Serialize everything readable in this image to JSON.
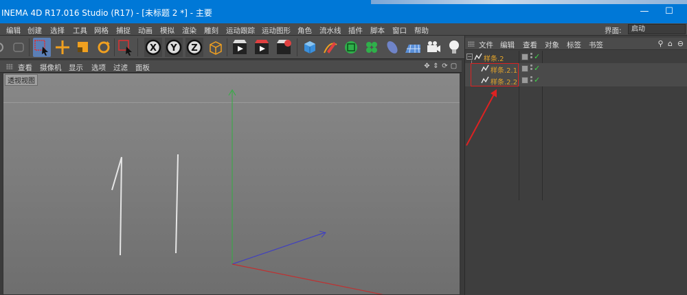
{
  "window": {
    "title": "INEMA 4D R17.016 Studio (R17) - [未标题 2 *] - 主要",
    "minimize_glyph": "—",
    "maximize_glyph": "☐"
  },
  "menubar": {
    "items": [
      "编辑",
      "创建",
      "选择",
      "工具",
      "网格",
      "捕捉",
      "动画",
      "模拟",
      "渲染",
      "雕刻",
      "运动跟踪",
      "运动图形",
      "角色",
      "流水线",
      "插件",
      "脚本",
      "窗口",
      "帮助"
    ],
    "layout_label": "界面:",
    "layout_value": "启动"
  },
  "toolbar": {
    "axis_x": "X",
    "axis_y": "Y",
    "axis_z": "Z"
  },
  "viewport_menu": {
    "items": [
      "查看",
      "摄像机",
      "显示",
      "选项",
      "过滤",
      "面板"
    ]
  },
  "viewport": {
    "label": "透视视图"
  },
  "object_manager": {
    "menu": [
      "文件",
      "编辑",
      "查看",
      "对象",
      "标签",
      "书签"
    ],
    "objects": [
      {
        "name": "样条.2"
      },
      {
        "name": "样条.2.1"
      },
      {
        "name": "样条.2.2"
      }
    ]
  },
  "colors": {
    "title_bar": "#0078d7",
    "object_name": "#e6a52a",
    "axis_x": "#c03030",
    "axis_y": "#30b040",
    "axis_z": "#4040c0",
    "annotation": "#dd2222"
  }
}
